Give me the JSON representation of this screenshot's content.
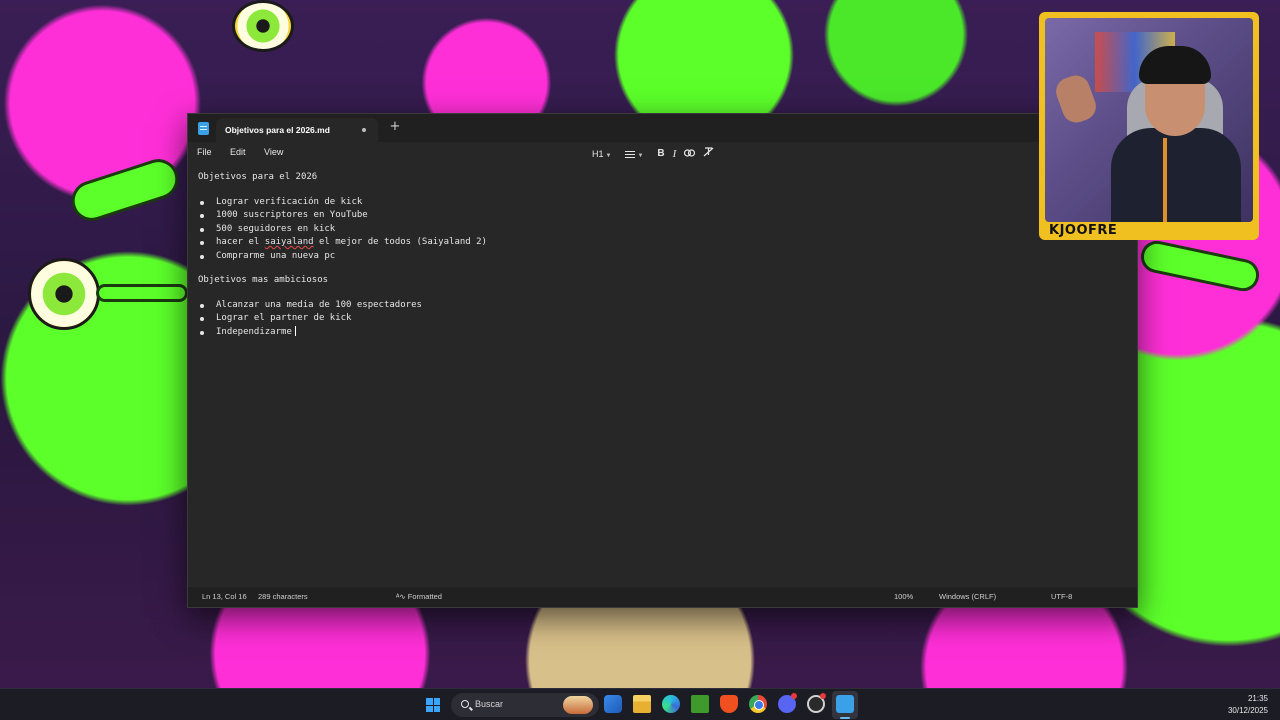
{
  "window": {
    "tab_title": "Objetivos para el 2026.md",
    "new_tab": "+"
  },
  "menu": {
    "file": "File",
    "edit": "Edit",
    "view": "View"
  },
  "toolbar": {
    "heading": "H1",
    "bold": "B",
    "italic": "I",
    "link_icon": "link-icon",
    "clear_format_icon": "clear-formatting-icon"
  },
  "document": {
    "heading1": "Objetivos para el 2026",
    "list1": [
      "Lograr verificación de kick",
      "1000 suscriptores en YouTube",
      "500 seguidores en kick",
      "hacer el saiyaland el mejor de todos (Saiyaland 2)",
      "Comprarme una nueva pc"
    ],
    "heading2": "Objetivos mas ambiciosos",
    "list2": [
      "Alcanzar una media de 100 espectadores",
      "Lograr el partner de kick",
      "Independizarme"
    ]
  },
  "status": {
    "position": "Ln 13, Col 16",
    "characters": "289 characters",
    "format": "Formatted",
    "zoom": "100%",
    "line_endings": "Windows (CRLF)",
    "encoding": "UTF-8"
  },
  "webcam": {
    "name": "KJOOFRE"
  },
  "taskbar": {
    "search_placeholder": "Buscar",
    "time": "21:35",
    "date": "30/12/2025",
    "apps": [
      "widgets-icon",
      "file-explorer-icon",
      "edge-icon",
      "minecraft-icon",
      "brave-icon",
      "chrome-icon",
      "discord-icon",
      "obs-icon",
      "notepad-icon"
    ]
  },
  "colors": {
    "window_bg": "#272727",
    "titlebar_bg": "#202020",
    "webcam_frame": "#f0c020",
    "accent": "#3aa0e8",
    "spellcheck": "#e84a4a"
  }
}
